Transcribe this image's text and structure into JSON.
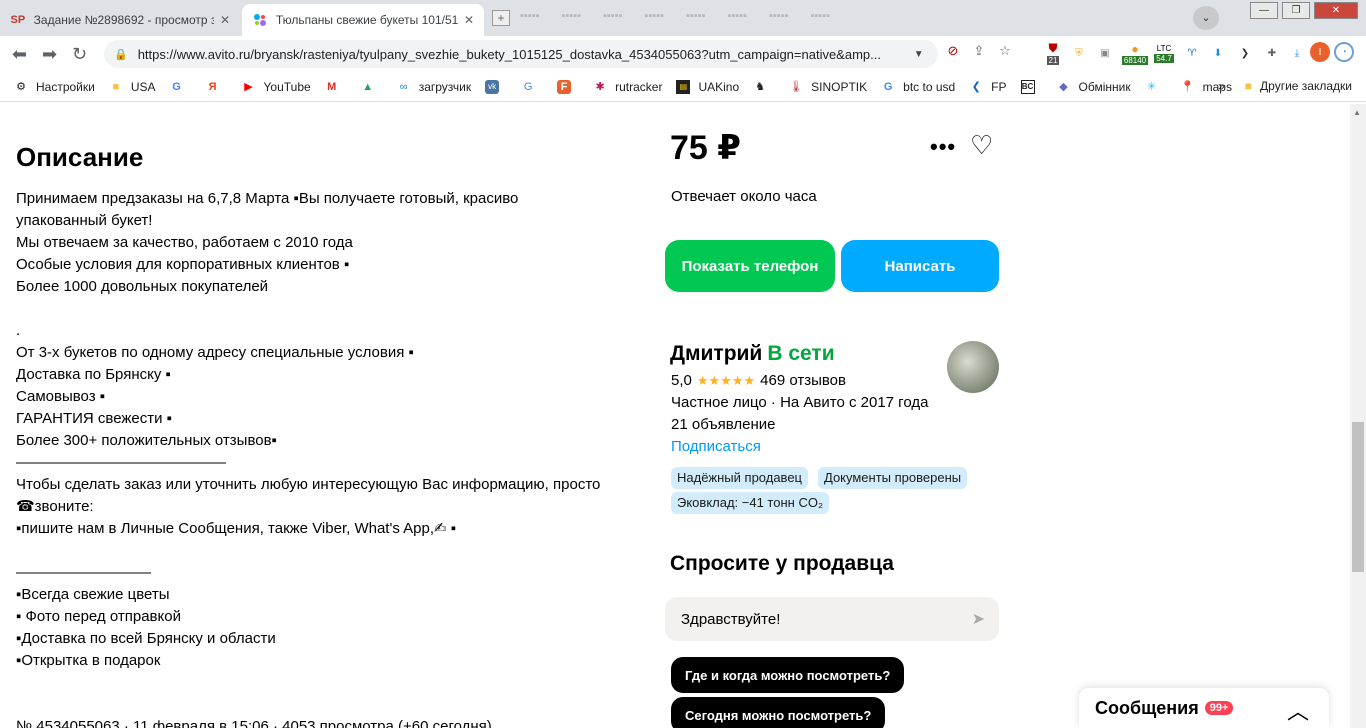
{
  "browser": {
    "tabs": [
      {
        "label": "Задание №2898692 - просмотр з",
        "favicon": "SP",
        "close": "✕"
      },
      {
        "label": "Тюльпаны свежие букеты 101/51",
        "favicon": "avito",
        "close": "✕"
      }
    ],
    "new_tab": "+",
    "url": "https://www.avito.ru/bryansk/rasteniya/tyulpany_svezhie_bukety_1015125_dostavka_4534055063?utm_campaign=native&amp...",
    "extension_badges": {
      "counter": "21",
      "btc": "68140",
      "ltc_label": "LTC",
      "ltc_value": "54.7"
    },
    "profile_letter": "I",
    "bookmarks": [
      "Настройки",
      "USA",
      "YouTube",
      "загрузчик",
      "rutracker",
      "UAKino",
      "SINOPTIK",
      "btc to usd",
      "FP",
      "Обмінник",
      "maps"
    ],
    "bookmarks_more": "»",
    "other_bookmarks": "Другие закладки"
  },
  "description": {
    "title": "Описание",
    "lines": [
      "Принимаем предзаказы на 6,7,8 Марта ▪Вы получаете готовый, красиво",
      "упакованный букет!",
      "Мы отвечаем за качество, работаем с 2010 года",
      "Особые условия для корпоративных клиентов ▪",
      "Более 1000 довольных покупателей",
      "",
      ".",
      "От 3-х букетов по одному адресу специальные условия ▪",
      "Доставка по Брянску ▪",
      "Самовывоз ▪",
      "ГАРАНТИЯ свежести ▪",
      "Более 300+ положительных отзывов▪",
      "——————————————",
      "Чтобы сделать заказ или уточнить любую интересующую Вас информацию, просто",
      "☎звоните:",
      "▪пишите нам в Личные Сообщения, также Viber, What's App,✍ ▪",
      "",
      "—————————",
      "▪Всегда свежие цветы",
      "▪ Фото перед отправкой",
      "▪Доставка по всей Брянску и области",
      "▪Открытка в подарок",
      "",
      "",
      "№ 4534055063 · 11 февраля в 15:06 · 4053 просмотра (+60 сегодня)"
    ]
  },
  "listing": {
    "price": "75 ₽",
    "more": "•••",
    "favorite": "♡",
    "reply_time": "Отвечает около часа",
    "show_phone": "Показать телефон",
    "write": "Написать"
  },
  "seller": {
    "name": "Дмитрий",
    "status": "В сети",
    "rating": "5,0",
    "stars": "★★★★★",
    "reviews": "469 отзывов",
    "type": "Частное лицо · На Авито с 2017 года",
    "ads": "21 объявление",
    "subscribe": "Подписаться",
    "tags": [
      "Надёжный продавец",
      "Документы проверены",
      "Эковклад: −41 тонн CO₂"
    ]
  },
  "ask": {
    "title": "Спросите у продавца",
    "placeholder": "Здравствуйте!",
    "send": "➤",
    "chips": [
      "Где и когда можно посмотреть?",
      "Сегодня можно посмотреть?"
    ]
  },
  "messages": {
    "label": "Сообщения",
    "badge": "99+",
    "chevron": "︿"
  }
}
